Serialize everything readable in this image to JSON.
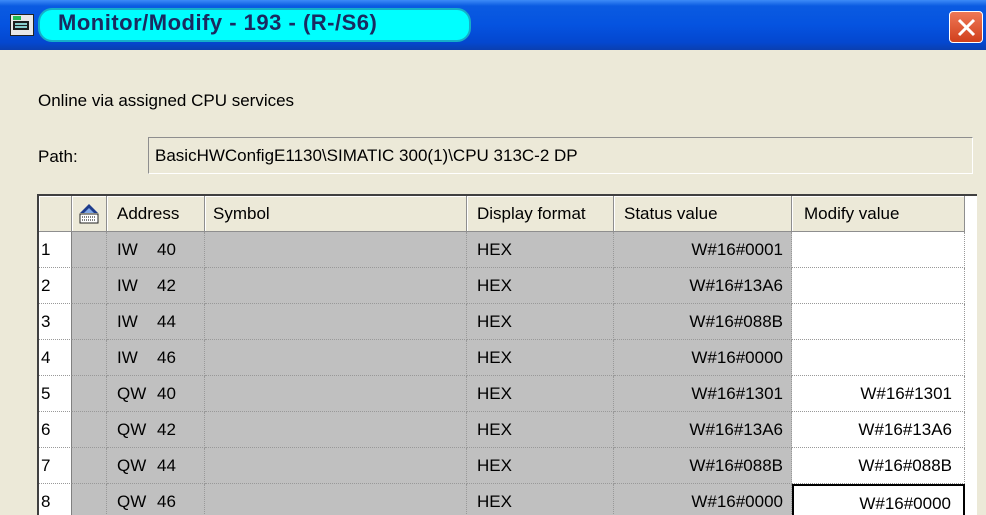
{
  "window": {
    "title": "Monitor/Modify - 193 - (R-/S6)",
    "icons": {
      "app": "monitor-app-icon",
      "close": "close-icon"
    },
    "colors": {
      "title_highlight": "#00FFFF",
      "titlebar": "#0553E0",
      "close": "#D1401C"
    }
  },
  "status": {
    "online_text": "Online via assigned CPU services"
  },
  "path": {
    "label": "Path:",
    "value": "BasicHWConfigE1130\\SIMATIC 300(1)\\CPU 313C-2 DP"
  },
  "table": {
    "headers": {
      "icon": "column-settings-icon",
      "address": "Address",
      "symbol": "Symbol",
      "display_format": "Display format",
      "status_value": "Status value",
      "modify_value": "Modify value"
    },
    "rows": [
      {
        "index": "1",
        "area": "IW",
        "offset": "40",
        "symbol": "",
        "format": "HEX",
        "status": "W#16#0001",
        "modify": ""
      },
      {
        "index": "2",
        "area": "IW",
        "offset": "42",
        "symbol": "",
        "format": "HEX",
        "status": "W#16#13A6",
        "modify": ""
      },
      {
        "index": "3",
        "area": "IW",
        "offset": "44",
        "symbol": "",
        "format": "HEX",
        "status": "W#16#088B",
        "modify": ""
      },
      {
        "index": "4",
        "area": "IW",
        "offset": "46",
        "symbol": "",
        "format": "HEX",
        "status": "W#16#0000",
        "modify": ""
      },
      {
        "index": "5",
        "area": "QW",
        "offset": "40",
        "symbol": "",
        "format": "HEX",
        "status": "W#16#1301",
        "modify": "W#16#1301"
      },
      {
        "index": "6",
        "area": "QW",
        "offset": "42",
        "symbol": "",
        "format": "HEX",
        "status": "W#16#13A6",
        "modify": "W#16#13A6"
      },
      {
        "index": "7",
        "area": "QW",
        "offset": "44",
        "symbol": "",
        "format": "HEX",
        "status": "W#16#088B",
        "modify": "W#16#088B"
      },
      {
        "index": "8",
        "area": "QW",
        "offset": "46",
        "symbol": "",
        "format": "HEX",
        "status": "W#16#0000",
        "modify": "W#16#0000"
      }
    ]
  }
}
